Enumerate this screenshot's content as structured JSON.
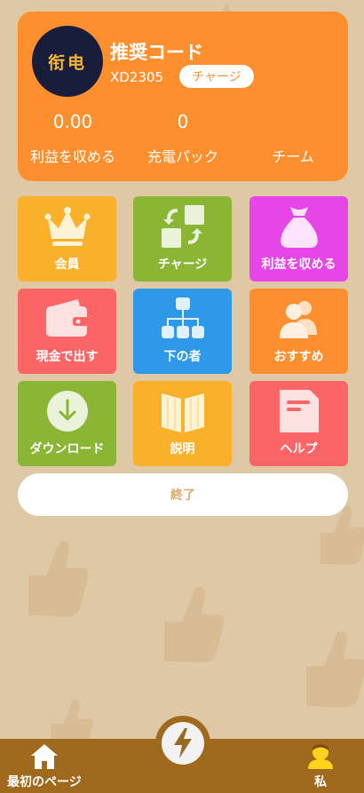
{
  "profile": {
    "avatar_text": "衔电",
    "title": "推奨コード",
    "code": "XD2305",
    "charge_label": "チャージ",
    "stats": [
      {
        "value": "0.00",
        "label": "利益を収める"
      },
      {
        "value": "0",
        "label": "充電パック"
      },
      {
        "value": "",
        "label": "チーム"
      }
    ]
  },
  "tiles": [
    {
      "label": "会員",
      "color": "#fbb02b",
      "icon": "crown-icon"
    },
    {
      "label": "チャージ",
      "color": "#8ab535",
      "icon": "exchange-icon"
    },
    {
      "label": "利益を収める",
      "color": "#e645e8",
      "icon": "money-bag-icon"
    },
    {
      "label": "現金で出す",
      "color": "#fb6566",
      "icon": "wallet-icon"
    },
    {
      "label": "下の者",
      "color": "#2d99e8",
      "icon": "hierarchy-icon"
    },
    {
      "label": "おすすめ",
      "color": "#fd8f2e",
      "icon": "users-icon"
    },
    {
      "label": "ダウンロード",
      "color": "#8ab535",
      "icon": "download-icon"
    },
    {
      "label": "説明",
      "color": "#fbb02b",
      "icon": "book-icon"
    },
    {
      "label": "ヘルプ",
      "color": "#fb6566",
      "icon": "document-icon"
    }
  ],
  "exit_label": "終了",
  "nav": {
    "home_label": "最初のページ",
    "center_icon": "lightning-icon",
    "me_label": "私"
  }
}
